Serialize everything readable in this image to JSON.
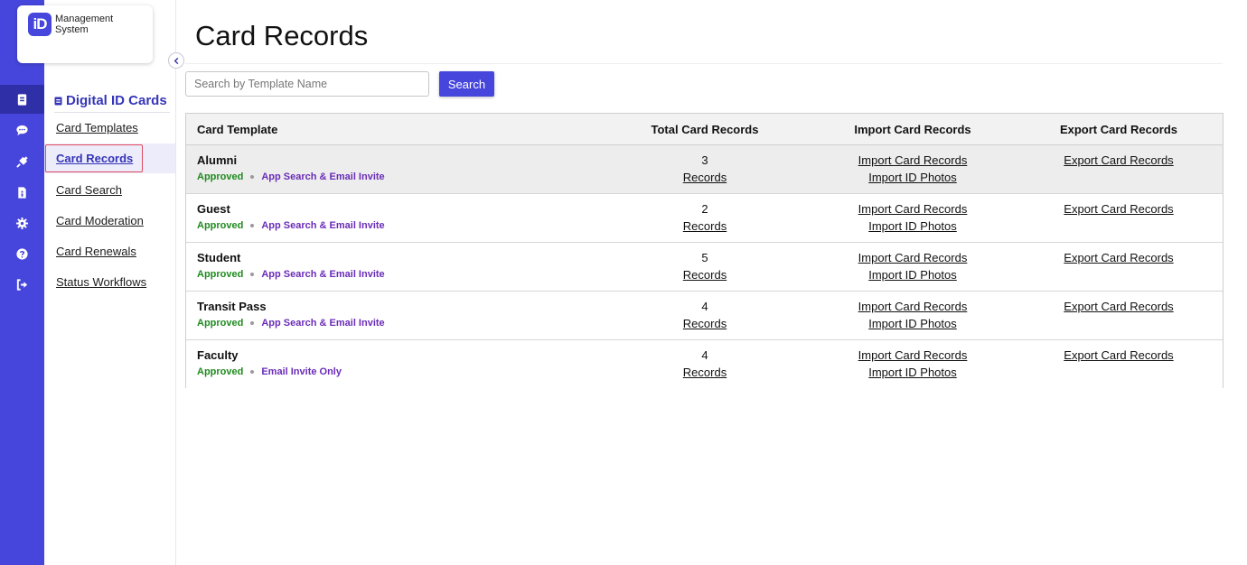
{
  "logo": {
    "mark": "iD",
    "line1": "Management",
    "line2": "System"
  },
  "rail": [
    {
      "icon": "id-card-icon",
      "active": true
    },
    {
      "icon": "chat-icon",
      "active": false
    },
    {
      "icon": "plug-icon",
      "active": false
    },
    {
      "icon": "document-icon",
      "active": false
    },
    {
      "icon": "gear-icon",
      "active": false
    },
    {
      "icon": "help-icon",
      "active": false
    },
    {
      "icon": "logout-icon",
      "active": false
    }
  ],
  "subnav": {
    "heading": "Digital ID Cards",
    "items": [
      "Card Templates",
      "Card Records",
      "Card Search",
      "Card Moderation",
      "Card Renewals",
      "Status Workflows"
    ],
    "active_index": 1
  },
  "page": {
    "title": "Card Records"
  },
  "search": {
    "placeholder": "Search by Template Name",
    "value": "",
    "button_label": "Search"
  },
  "table": {
    "columns": [
      "Card Template",
      "Total Card Records",
      "Import Card Records",
      "Export Card Records"
    ],
    "rows": [
      {
        "name": "Alumni",
        "status": "Approved",
        "channel": "App Search & Email Invite",
        "count": "3",
        "records_link": "Records",
        "import_records": "Import Card Records",
        "import_photos": "Import ID Photos",
        "export_records": "Export Card Records",
        "highlighted": true
      },
      {
        "name": "Guest",
        "status": "Approved",
        "channel": "App Search & Email Invite",
        "count": "2",
        "records_link": "Records",
        "import_records": "Import Card Records",
        "import_photos": "Import ID Photos",
        "export_records": "Export Card Records",
        "highlighted": false
      },
      {
        "name": "Student",
        "status": "Approved",
        "channel": "App Search & Email Invite",
        "count": "5",
        "records_link": "Records",
        "import_records": "Import Card Records",
        "import_photos": "Import ID Photos",
        "export_records": "Export Card Records",
        "highlighted": false
      },
      {
        "name": "Transit Pass",
        "status": "Approved",
        "channel": "App Search & Email Invite",
        "count": "4",
        "records_link": "Records",
        "import_records": "Import Card Records",
        "import_photos": "Import ID Photos",
        "export_records": "Export Card Records",
        "highlighted": false
      },
      {
        "name": "Faculty",
        "status": "Approved",
        "channel": "Email Invite Only",
        "count": "4",
        "records_link": "Records",
        "import_records": "Import Card Records",
        "import_photos": "Import ID Photos",
        "export_records": "Export Card Records",
        "highlighted": false
      }
    ]
  },
  "colors": {
    "brand": "#4646dc",
    "brand_dark": "#2f2fa8",
    "approved": "#1f8a1f",
    "channel": "#6a2cb8",
    "selection_outline": "#e04a5e"
  }
}
